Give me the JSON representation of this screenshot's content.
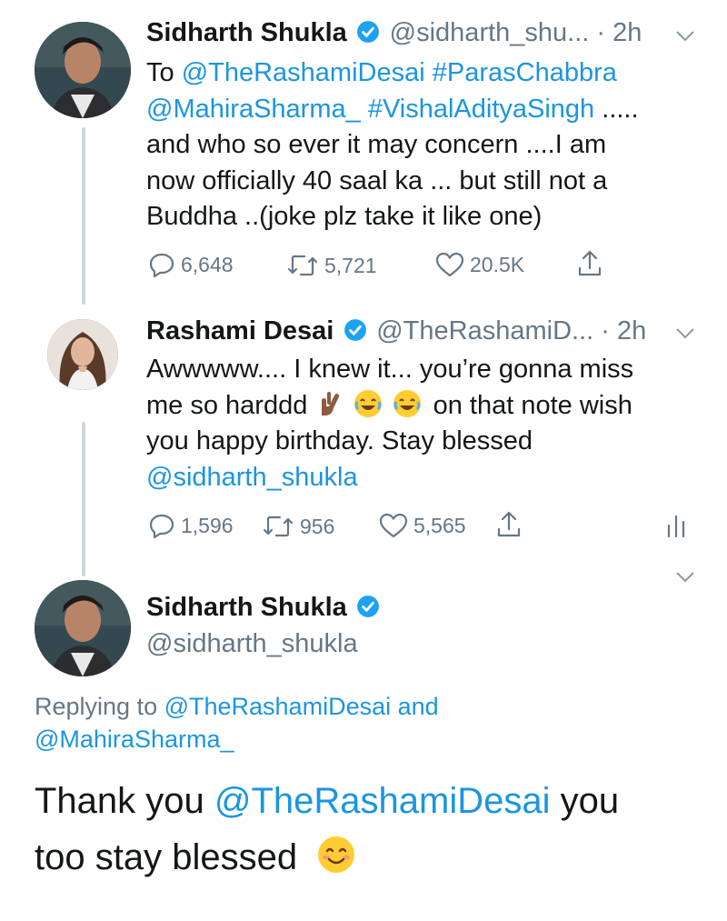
{
  "tweets": [
    {
      "name": "Sidharth Shukla",
      "handle": "@sidharth_shu...",
      "sep": " · ",
      "time": "2h",
      "body_prefix": "To ",
      "mention1": "@TheRashamiDesai",
      "hashtag1": "#ParasChabbra",
      "mention2": "@MahiraSharma_",
      "hashtag2": "#VishalAdityaSingh",
      "body_rest1": " .....",
      "line3": "and who so ever it may concern ....I am",
      "line4": "now officially 40 saal ka ... but still not a",
      "line5": "Buddha ..(joke plz take it like one)",
      "replies": "6,648",
      "retweets": "5,721",
      "likes": "20.5K"
    },
    {
      "name": "Rashami Desai",
      "handle": "@TheRashamiD...",
      "sep": " · ",
      "time": "2h",
      "line1": "Awwwww.... I knew it... you’re gonna miss",
      "line2_a": "me so harddd",
      "line2_b": "on that note wish",
      "line3": "you happy birthday. Stay blessed",
      "mention": "@sidharth_shukla",
      "replies": "1,596",
      "retweets": "956",
      "likes": "5,565"
    }
  ],
  "main_tweet": {
    "name": "Sidharth Shukla",
    "handle": "@sidharth_shukla",
    "replying_prefix": "Replying to ",
    "replying_mention1": "@TheRashamiDesai",
    "replying_and": " and",
    "replying_mention2": "@MahiraSharma_",
    "text_a": "Thank you ",
    "text_mention": "@TheRashamiDesai",
    "text_b": " you",
    "text_line2": "too stay blessed"
  },
  "colors": {
    "link": "#1b95e0",
    "secondary": "#657786",
    "verified": "#1da1f2",
    "thread_line": "#cdd6dd"
  },
  "icons": [
    "reply-icon",
    "retweet-icon",
    "like-icon",
    "share-icon",
    "analytics-icon",
    "chevron-down-icon",
    "verified-badge-icon"
  ]
}
